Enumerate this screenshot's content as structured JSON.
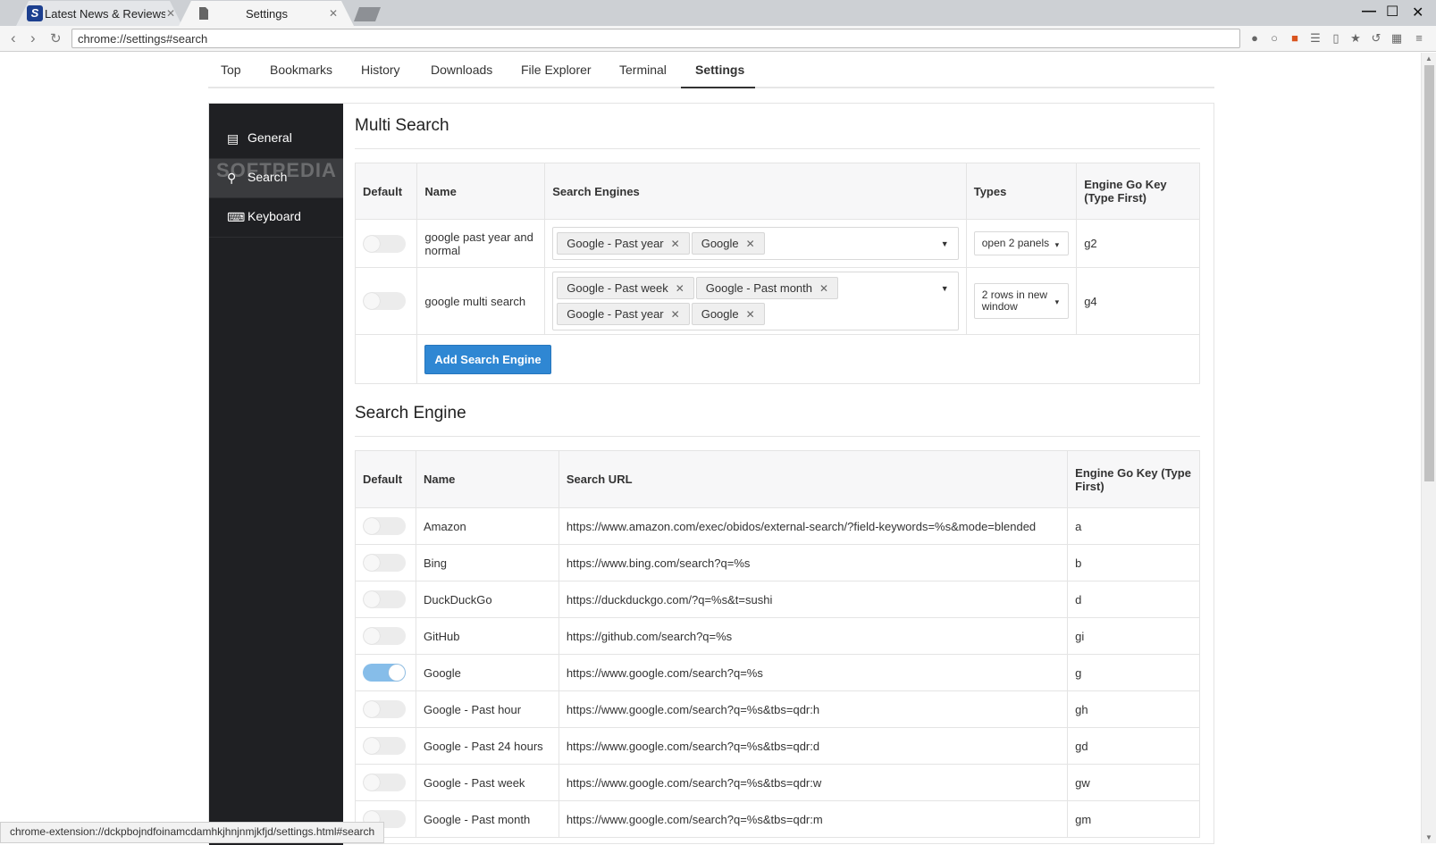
{
  "browser": {
    "tabs": [
      {
        "title": "Latest News & Reviews",
        "active": false
      },
      {
        "title": "Settings",
        "active": true
      }
    ],
    "address": "chrome://settings#search",
    "status_url": "chrome-extension://dckpbojndfoinamcdamhkjhnjnmjkfjd/settings.html#search"
  },
  "topnav": {
    "items": [
      "Top",
      "Bookmarks",
      "History",
      "Downloads",
      "File Explorer",
      "Terminal",
      "Settings"
    ],
    "active": "Settings"
  },
  "sidebar": {
    "items": [
      {
        "label": "General",
        "icon": "list-icon"
      },
      {
        "label": "Search",
        "icon": "search-icon"
      },
      {
        "label": "Keyboard",
        "icon": "keyboard-icon"
      }
    ],
    "active": "Search",
    "watermark": "SOFTPEDIA"
  },
  "multi_search": {
    "title": "Multi Search",
    "headers": {
      "default": "Default",
      "name": "Name",
      "engines": "Search Engines",
      "types": "Types",
      "key": "Engine Go Key (Type First)"
    },
    "rows": [
      {
        "default": false,
        "name": "google past year and normal",
        "engines": [
          "Google - Past year",
          "Google"
        ],
        "type": "open 2 panels",
        "key": "g2"
      },
      {
        "default": false,
        "name": "google multi search",
        "engines": [
          "Google - Past week",
          "Google - Past month",
          "Google - Past year",
          "Google"
        ],
        "type": "2 rows in new window",
        "key": "g4"
      }
    ],
    "add_button": "Add Search Engine"
  },
  "search_engine": {
    "title": "Search Engine",
    "headers": {
      "default": "Default",
      "name": "Name",
      "url": "Search URL",
      "key": "Engine Go Key (Type First)"
    },
    "rows": [
      {
        "default": false,
        "name": "Amazon",
        "url": "https://www.amazon.com/exec/obidos/external-search/?field-keywords=%s&mode=blended",
        "key": "a"
      },
      {
        "default": false,
        "name": "Bing",
        "url": "https://www.bing.com/search?q=%s",
        "key": "b"
      },
      {
        "default": false,
        "name": "DuckDuckGo",
        "url": "https://duckduckgo.com/?q=%s&t=sushi",
        "key": "d"
      },
      {
        "default": false,
        "name": "GitHub",
        "url": "https://github.com/search?q=%s",
        "key": "gi"
      },
      {
        "default": true,
        "name": "Google",
        "url": "https://www.google.com/search?q=%s",
        "key": "g"
      },
      {
        "default": false,
        "name": "Google - Past hour",
        "url": "https://www.google.com/search?q=%s&tbs=qdr:h",
        "key": "gh"
      },
      {
        "default": false,
        "name": "Google - Past 24 hours",
        "url": "https://www.google.com/search?q=%s&tbs=qdr:d",
        "key": "gd"
      },
      {
        "default": false,
        "name": "Google - Past week",
        "url": "https://www.google.com/search?q=%s&tbs=qdr:w",
        "key": "gw"
      },
      {
        "default": false,
        "name": "Google - Past month",
        "url": "https://www.google.com/search?q=%s&tbs=qdr:m",
        "key": "gm"
      }
    ]
  },
  "colors": {
    "sidebar_bg": "#1f2023",
    "accent": "#2f87d3",
    "toggle_on": "#86bde9"
  }
}
